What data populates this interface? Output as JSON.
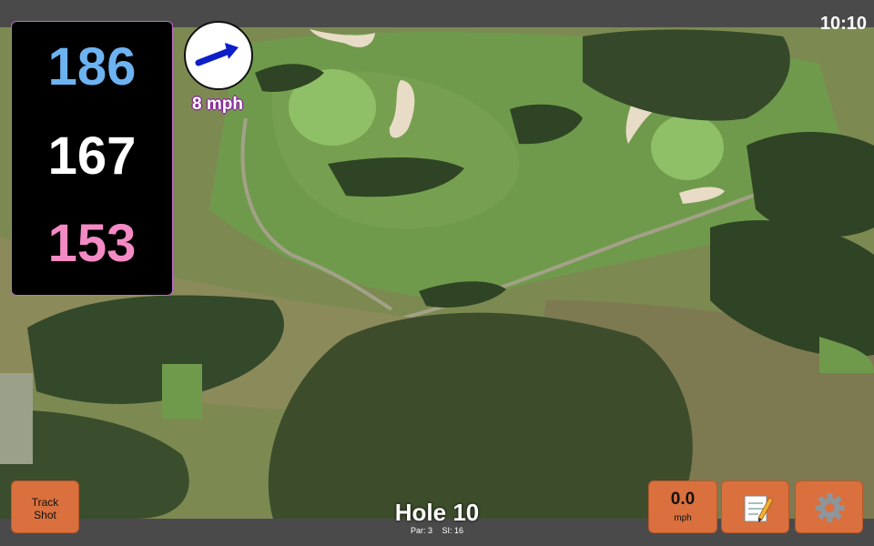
{
  "status": {
    "time": "10:10"
  },
  "distances": {
    "back": "186",
    "middle": "167",
    "front": "153"
  },
  "wind": {
    "speed_label": "8 mph",
    "icon": "arrow-icon"
  },
  "hole": {
    "title": "Hole 10",
    "par": "Par: 3",
    "si": "SI: 16"
  },
  "buttons": {
    "track_shot_line1": "Track",
    "track_shot_line2": "Shot",
    "speed_value": "0.0",
    "speed_unit": "mph",
    "notes_icon": "notepad-icon",
    "settings_icon": "gear-icon"
  },
  "colors": {
    "back": "#6db3f2",
    "middle": "#ffffff",
    "front": "#f48ac4",
    "wind_arrow": "#0d1ec8",
    "button": "#d9703d"
  }
}
